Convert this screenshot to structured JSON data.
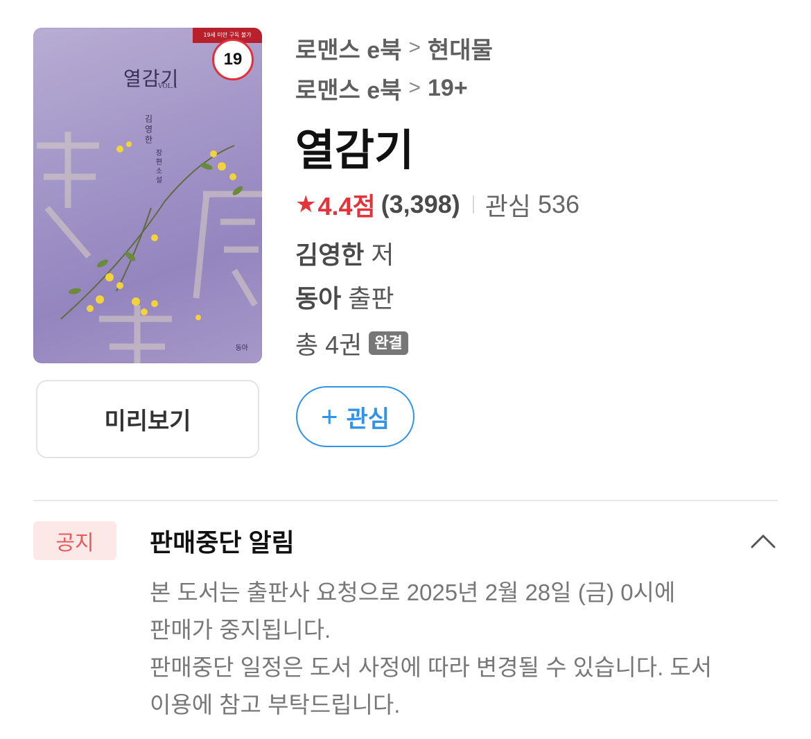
{
  "cover": {
    "ribbon": "19세 미만 구독 불가",
    "age_badge": "19",
    "title": "열감기",
    "vol": "VOL.1",
    "author": "김영한",
    "subtitle": "장편소설",
    "publisher": "동아"
  },
  "preview_label": "미리보기",
  "breadcrumbs": [
    {
      "category": "로맨스 e북",
      "sub": "현대물"
    },
    {
      "category": "로맨스 e북",
      "sub": "19+"
    }
  ],
  "breadcrumb_sep": ">",
  "title": "열감기",
  "rating": {
    "star": "★",
    "value": "4.4점",
    "count": "(3,398)",
    "interest_label": "관심",
    "interest_count": "536"
  },
  "author": {
    "name": "김영한",
    "suffix": "저"
  },
  "publisher": {
    "name": "동아",
    "suffix": "출판"
  },
  "volumes": {
    "text": "총 4권",
    "badge": "완결"
  },
  "favorite": {
    "plus": "+",
    "label": "관심"
  },
  "notice": {
    "tag": "공지",
    "title": "판매중단 알림",
    "lines": [
      "본 도서는 출판사 요청으로 2025년 2월 28일 (금) 0시에",
      "판매가 중지됩니다.",
      "판매중단 일정은 도서 사정에 따라 변경될 수 있습니다. 도서",
      "이용에 참고 부탁드립니다."
    ]
  },
  "colors": {
    "accent_red": "#e3343c",
    "accent_blue": "#2e93ea",
    "notice_bg": "#fde8e8"
  }
}
